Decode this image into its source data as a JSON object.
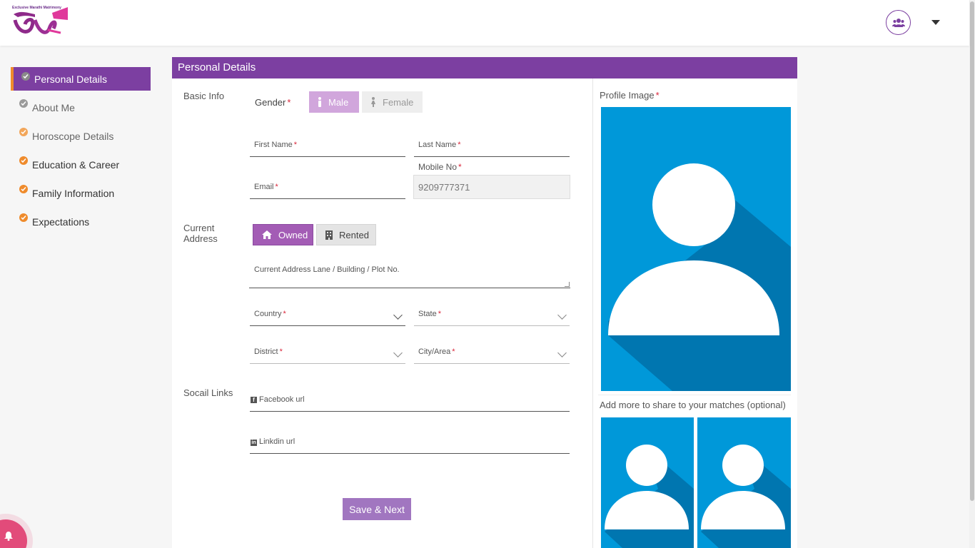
{
  "header": {
    "logo_tagline": "Exclusive Marathi Matrimony",
    "logo_mark": "स्थळ",
    "logo_sub": "मराठी",
    "account_icon": "users-icon",
    "menu_icon": "caret-down-icon"
  },
  "sidebar": {
    "items": [
      {
        "label": "Personal Details",
        "icon": "check-circle-icon"
      },
      {
        "label": "About Me",
        "icon": "check-circle-icon"
      },
      {
        "label": "Horoscope Details",
        "icon": "check-circle-icon"
      },
      {
        "label": "Education & Career",
        "icon": "check-circle-icon"
      },
      {
        "label": "Family Information",
        "icon": "check-circle-icon"
      },
      {
        "label": "Expectations",
        "icon": "check-circle-icon"
      }
    ]
  },
  "form": {
    "title": "Personal Details",
    "basic_info_label": "Basic Info",
    "gender_label": "Gender",
    "gender_options": [
      "Male",
      "Female"
    ],
    "gender_selected": "Male",
    "first_name_label": "First Name",
    "last_name_label": "Last Name",
    "email_label": "Email",
    "mobile_label": "Mobile No",
    "mobile_value": "9209777371",
    "current_address_label_1": "Current",
    "current_address_label_2": "Address",
    "ownership_options": [
      "Owned",
      "Rented"
    ],
    "ownership_selected": "Owned",
    "address_placeholder": "Current Address Lane / Building / Plot No.",
    "country_label": "Country",
    "state_label": "State",
    "district_label": "District",
    "city_label": "City/Area",
    "social_label": "Socail Links",
    "facebook_label": "Facebook url",
    "linkedin_label": "Linkdin url",
    "save_label": "Save & Next"
  },
  "profile": {
    "image_label": "Profile Image",
    "add_more_label": "Add more to share to your matches (optional)"
  },
  "colors": {
    "primary": "#7c3fa1",
    "accent": "#ef8b2c",
    "required": "#d9263a",
    "photo_bg": "#0098d9"
  }
}
